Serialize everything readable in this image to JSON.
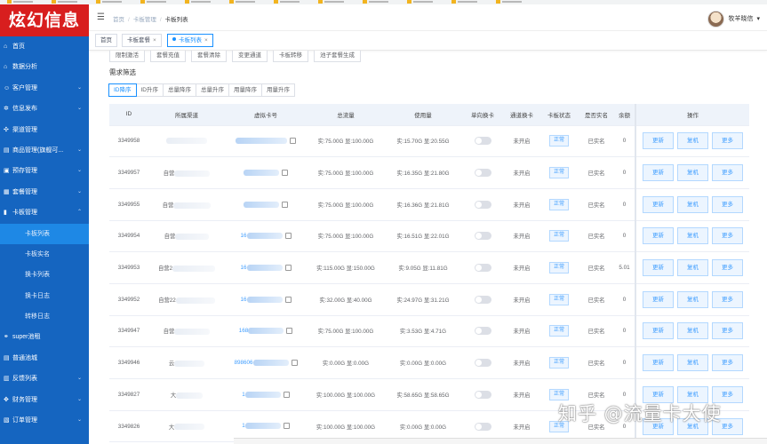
{
  "sidebar": {
    "logo": "炫幻信息",
    "items": [
      {
        "label": "首页",
        "icon": "home-icon",
        "glyph": "⌂",
        "caret": ""
      },
      {
        "label": "数据分析",
        "icon": "home-icon",
        "glyph": "⌂",
        "caret": ""
      },
      {
        "label": "客户管理",
        "icon": "users-icon",
        "glyph": "☺",
        "caret": "⌄"
      },
      {
        "label": "信息发布",
        "icon": "settings-icon",
        "glyph": "✲",
        "caret": "⌄"
      },
      {
        "label": "渠道管理",
        "icon": "channel-icon",
        "glyph": "✣",
        "caret": ""
      },
      {
        "label": "商品管理(旗舰可...",
        "icon": "goods-icon",
        "glyph": "▤",
        "caret": "⌄"
      },
      {
        "label": "预存管理",
        "icon": "wallet-icon",
        "glyph": "▣",
        "caret": "⌄"
      },
      {
        "label": "套餐管理",
        "icon": "package-icon",
        "glyph": "▦",
        "caret": "⌄"
      },
      {
        "label": "卡板管理",
        "icon": "card-icon",
        "glyph": "▮",
        "caret": "⌃"
      },
      {
        "label": "卡板列表",
        "sub": true,
        "active": true
      },
      {
        "label": "卡板实名",
        "sub": true
      },
      {
        "label": "换卡列表",
        "sub": true
      },
      {
        "label": "换卡日志",
        "sub": true
      },
      {
        "label": "转移日志",
        "sub": true
      },
      {
        "label": "super池租",
        "icon": "share-icon",
        "glyph": "⚭",
        "caret": ""
      },
      {
        "label": "普通池城",
        "icon": "pool-icon",
        "glyph": "▤",
        "caret": ""
      },
      {
        "label": "反馈列表",
        "icon": "feedback-icon",
        "glyph": "▥",
        "caret": "⌄"
      },
      {
        "label": "财务管理",
        "icon": "finance-icon",
        "glyph": "✥",
        "caret": "⌄"
      },
      {
        "label": "订单管理",
        "icon": "order-icon",
        "glyph": "▧",
        "caret": "⌄"
      }
    ]
  },
  "header": {
    "fold_glyph": "☰",
    "breadcrumb": [
      "首页",
      "卡板管理",
      "卡板列表"
    ],
    "user_name": "牧羊晓信",
    "dropdown_glyph": "▾"
  },
  "tabs": [
    {
      "label": "首页",
      "closable": false
    },
    {
      "label": "卡板套餐",
      "closable": true
    },
    {
      "label": "卡板列表",
      "closable": true,
      "active": true
    }
  ],
  "ops": [
    "限制激活",
    "套餐充值",
    "套餐清除",
    "变更通道",
    "卡板转移",
    "池子套餐生成"
  ],
  "filter_title": "需求筛选",
  "sort_buttons": [
    "ID降序",
    "ID升序",
    "总量降序",
    "总量升序",
    "用量降序",
    "用量升序"
  ],
  "table": {
    "columns": [
      "ID",
      "所属渠道",
      "虚拟卡号",
      "总流量",
      "使用量",
      "单向换卡",
      "通道换卡",
      "卡板状态",
      "是否实名",
      "余额",
      "操作"
    ],
    "rows": [
      {
        "id": "3349958",
        "channel": "",
        "vcard": "",
        "total": "实:75.00G 显:100.00G",
        "used": "实:15.70G 显:20.55G",
        "channel_switch": "未开启",
        "status": "正常",
        "realname": "已实名",
        "balance": "0"
      },
      {
        "id": "3349957",
        "channel": "自营",
        "vcard": "",
        "total": "实:75.00G 显:100.00G",
        "used": "实:16.35G 显:21.80G",
        "channel_switch": "未开启",
        "status": "正常",
        "realname": "已实名",
        "balance": "0"
      },
      {
        "id": "3349955",
        "channel": "自营",
        "vcard": "",
        "total": "实:75.00G 显:100.00G",
        "used": "实:16.36G 显:21.81G",
        "channel_switch": "未开启",
        "status": "正常",
        "realname": "已实名",
        "balance": "0"
      },
      {
        "id": "3349954",
        "channel": "自营",
        "vcard": "16",
        "total": "实:75.00G 显:100.00G",
        "used": "实:16.51G 显:22.01G",
        "channel_switch": "未开启",
        "status": "正常",
        "realname": "已实名",
        "balance": "0"
      },
      {
        "id": "3349953",
        "channel": "自营2",
        "vcard": "16",
        "total": "实:115.00G 显:150.00G",
        "used": "实:9.05G 显:11.81G",
        "channel_switch": "未开启",
        "status": "正常",
        "realname": "已实名",
        "balance": "5.01"
      },
      {
        "id": "3349952",
        "channel": "自营22",
        "vcard": "16",
        "total": "实:32.00G 显:40.00G",
        "used": "实:24.97G 显:31.21G",
        "channel_switch": "未开启",
        "status": "正常",
        "realname": "已实名",
        "balance": "0"
      },
      {
        "id": "3349947",
        "channel": "自营",
        "vcard": "168",
        "total": "实:75.00G 显:100.00G",
        "used": "实:3.53G 显:4.71G",
        "channel_switch": "未开启",
        "status": "正常",
        "realname": "已实名",
        "balance": "0"
      },
      {
        "id": "3349946",
        "channel": "云",
        "vcard": "898606",
        "total": "实:0.00G 显:0.00G",
        "used": "实:0.00G 显:0.00G",
        "channel_switch": "未开启",
        "status": "正常",
        "realname": "已实名",
        "balance": "0"
      },
      {
        "id": "3349827",
        "channel": "大",
        "vcard": "1",
        "total": "实:100.00G 显:100.00G",
        "used": "实:58.65G 显:58.65G",
        "channel_switch": "未开启",
        "status": "正常",
        "realname": "已实名",
        "balance": "0"
      },
      {
        "id": "3349826",
        "channel": "大",
        "vcard": "1",
        "total": "实:100.00G 显:100.00G",
        "used": "实:0.00G 显:0.00G",
        "channel_switch": "未开启",
        "status": "正常",
        "realname": "已实名",
        "balance": "0"
      }
    ],
    "actions": [
      "更新",
      "复机",
      "更多"
    ]
  },
  "watermark": "知乎 @流量卡大使",
  "colors": {
    "sidebar": "#1565c0",
    "logo_bg": "#d81e1e",
    "accent": "#1890ff",
    "active_nav": "#1e88e5"
  }
}
